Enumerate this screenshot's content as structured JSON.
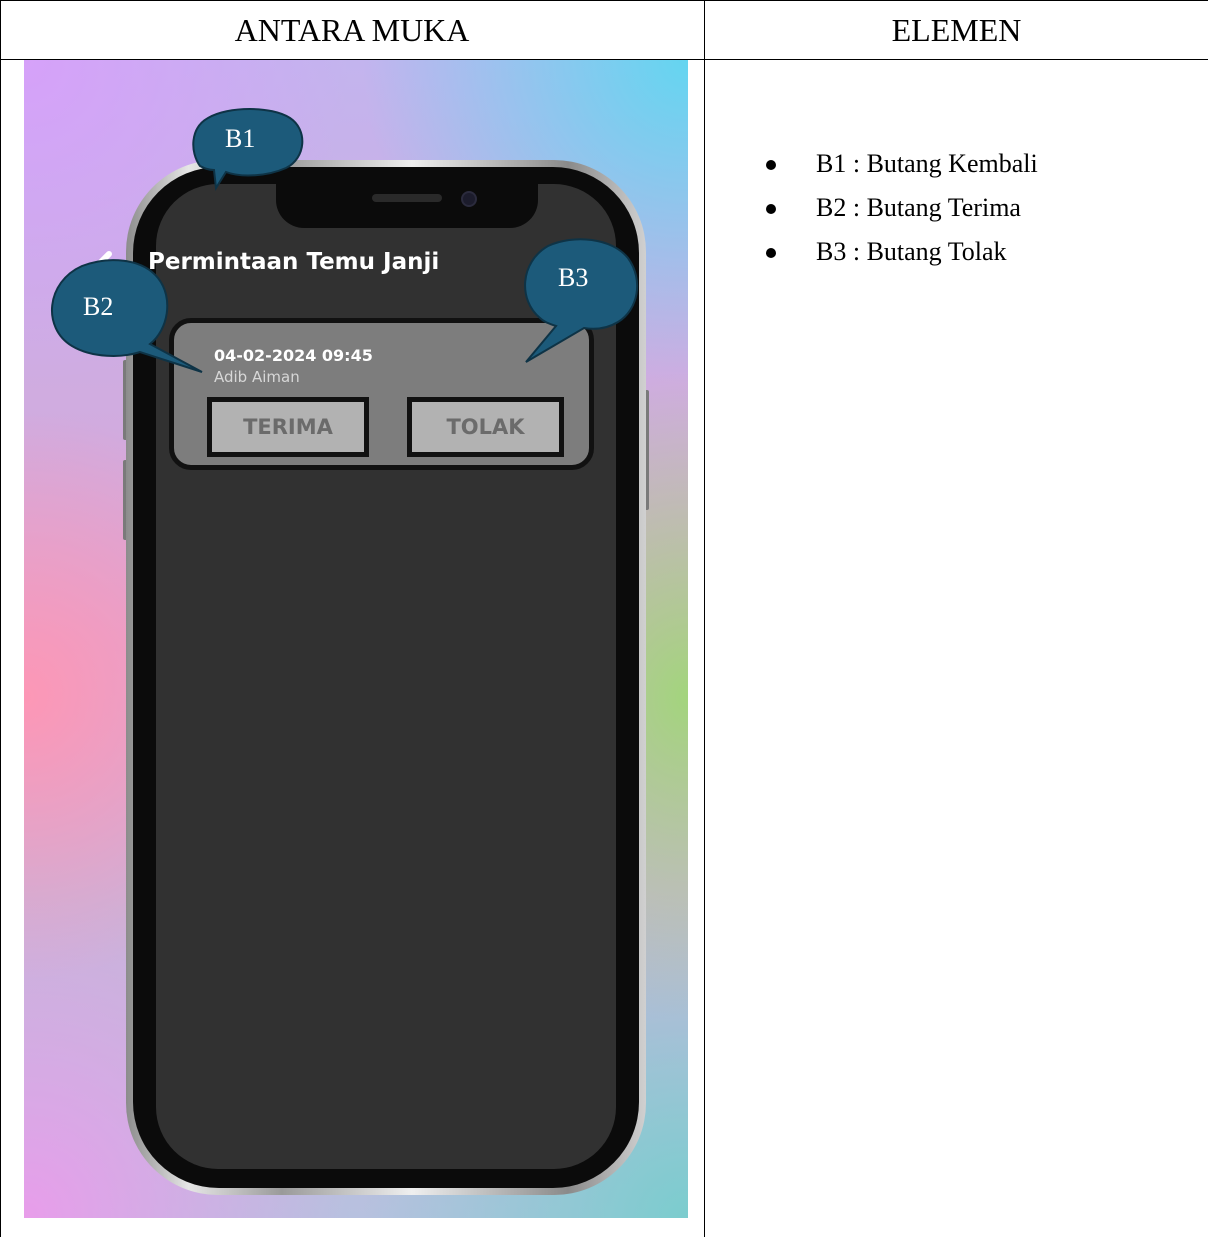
{
  "table": {
    "headers": [
      "ANTARA MUKA",
      "ELEMEN"
    ]
  },
  "screen": {
    "title": "Permintaan Temu Janji",
    "request": {
      "datetime": "04-02-2024 09:45",
      "name": "Adib Aiman",
      "accept_label": "TERIMA",
      "reject_label": "TOLAK"
    }
  },
  "callouts": [
    "B1",
    "B2",
    "B3"
  ],
  "legend": [
    "B1 : Butang Kembali",
    "B2 : Butang Terima",
    "B3 : Butang Tolak"
  ],
  "colors": {
    "callout_fill": "#1c5a7a",
    "screen_bg": "#313131",
    "card_bg": "#7d7d7d",
    "button_bg": "#b2b2b2"
  }
}
